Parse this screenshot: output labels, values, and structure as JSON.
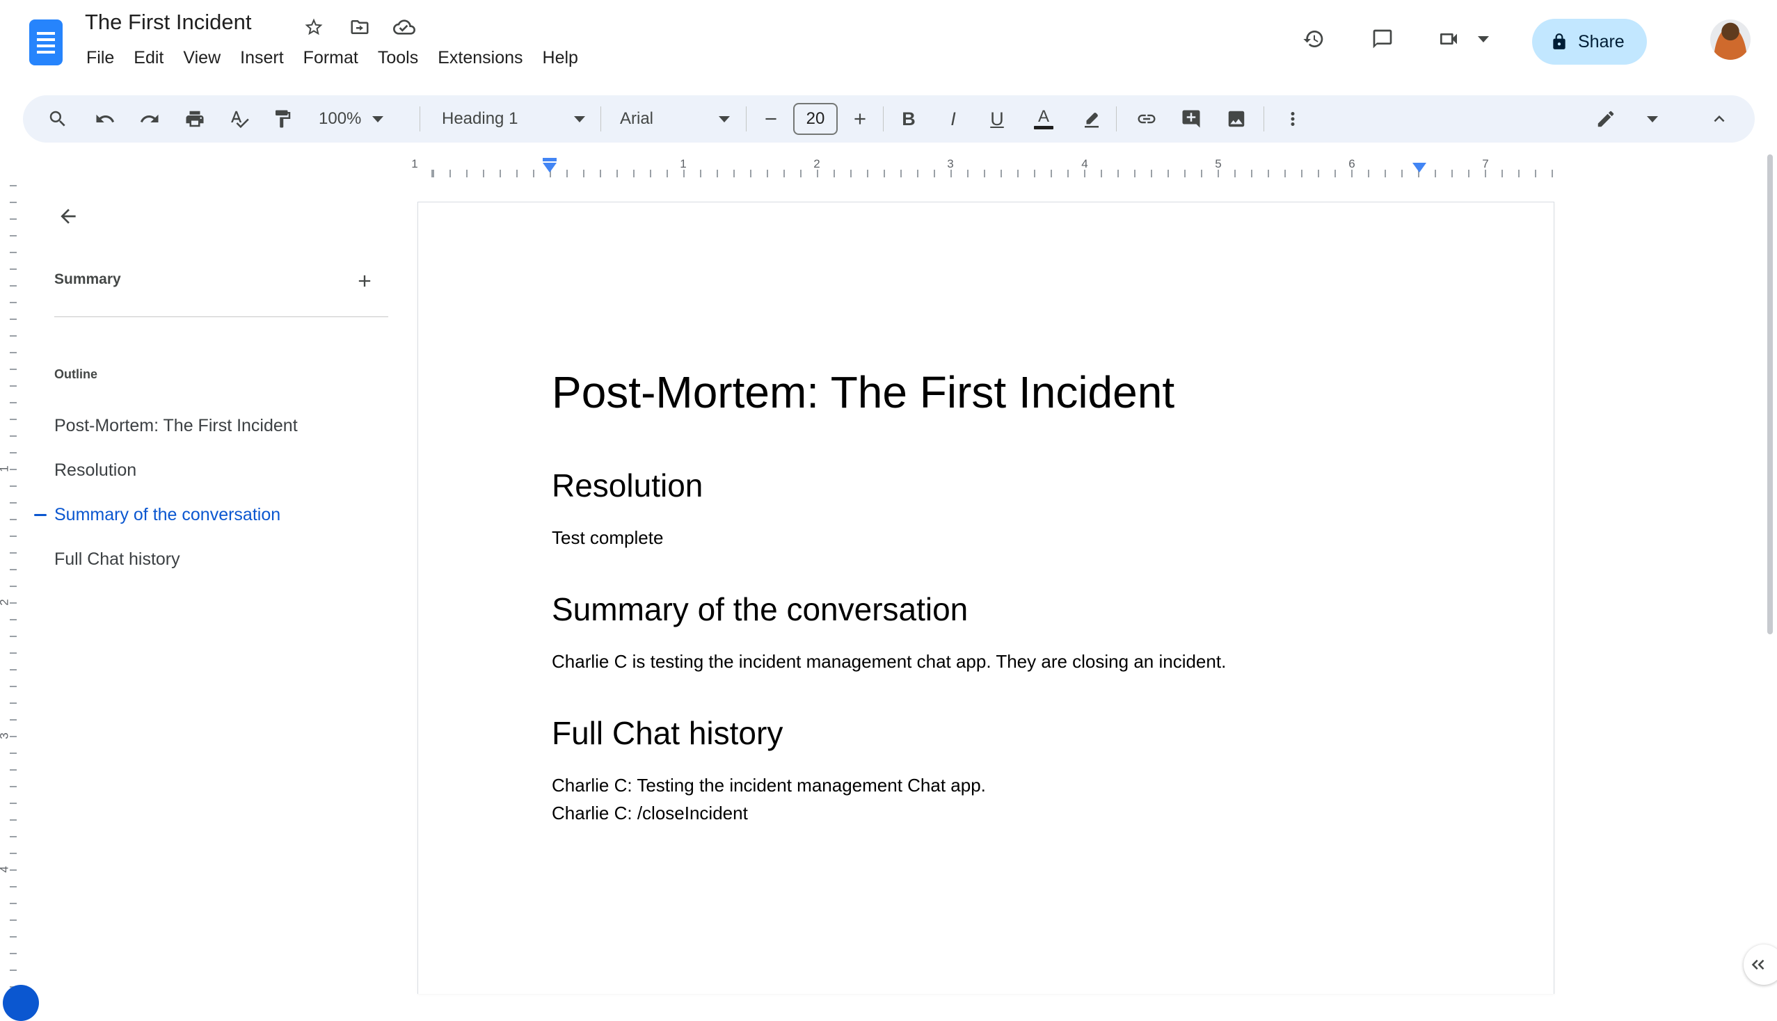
{
  "header": {
    "doc_title": "The First Incident",
    "menus": [
      "File",
      "Edit",
      "View",
      "Insert",
      "Format",
      "Tools",
      "Extensions",
      "Help"
    ],
    "share_label": "Share"
  },
  "toolbar": {
    "zoom_value": "100%",
    "paragraph_style": "Heading 1",
    "font_family": "Arial",
    "font_size": "20",
    "bold_label": "B",
    "italic_label": "I",
    "underline_label": "U",
    "text_color_label": "A"
  },
  "ruler": {
    "horizontal_labels": [
      "1",
      "1",
      "2",
      "3",
      "4",
      "5",
      "6",
      "7"
    ],
    "vertical_labels": [
      "1",
      "2",
      "3",
      "4"
    ]
  },
  "sidebar": {
    "summary_title": "Summary",
    "outline_title": "Outline",
    "outline_items": [
      "Post-Mortem: The First Incident",
      "Resolution",
      "Summary of the conversation",
      "Full Chat history"
    ],
    "active_item": "Summary of the conversation"
  },
  "document": {
    "heading1": "Post-Mortem: The First Incident",
    "sections": [
      {
        "heading": "Resolution",
        "body": "Test complete"
      },
      {
        "heading": "Summary of the conversation",
        "body": "Charlie C is testing the incident management chat app. They are closing an incident."
      },
      {
        "heading": "Full Chat history",
        "body_lines": [
          "Charlie C: Testing the incident management Chat app.",
          "Charlie C: /closeIncident"
        ]
      }
    ]
  },
  "colors": {
    "accent_blue": "#0b57d0",
    "share_button_bg": "#c2e7ff",
    "toolbar_bg": "#edf2fa",
    "docs_logo_blue": "#2684fc",
    "indent_marker_blue": "#4285f4"
  }
}
